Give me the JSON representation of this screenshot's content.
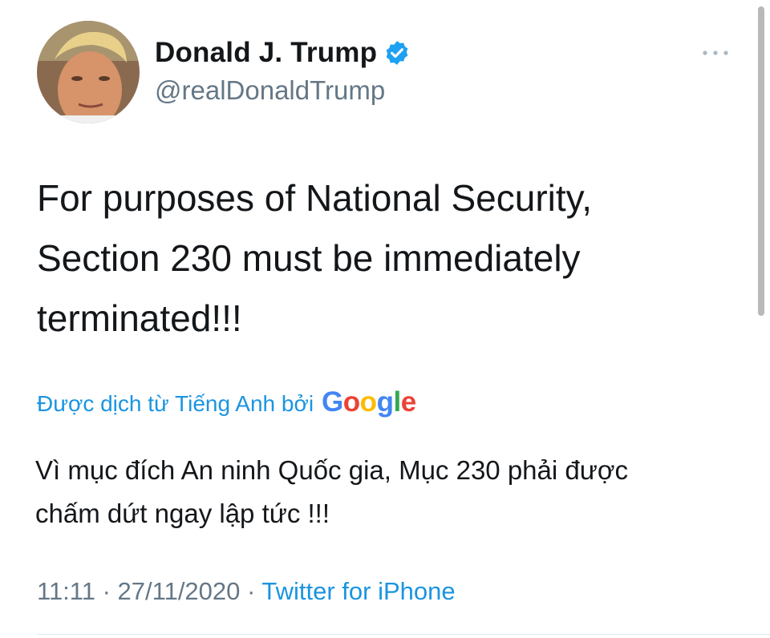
{
  "author": {
    "display_name": "Donald J. Trump",
    "handle": "@realDonaldTrump",
    "verified": true,
    "avatar_icon": "profile-photo"
  },
  "tweet": {
    "text_lines": [
      "For purposes of National Security,",
      "Section 230 must be immediately",
      "terminated!!!"
    ]
  },
  "translation": {
    "label": "Được dịch từ Tiếng Anh bởi",
    "provider": "Google",
    "text_lines": [
      "Vì mục đích An ninh Quốc gia, Mục 230 phải được",
      "chấm dứt ngay lập tức !!!"
    ]
  },
  "meta": {
    "time": "11:11",
    "separator": " · ",
    "date": "27/11/2020",
    "source": "Twitter for iPhone"
  },
  "colors": {
    "link": "#1b95e0",
    "secondary_text": "#657786",
    "verified_badge": "#1da1f2"
  },
  "icons": {
    "verified": "verified-badge-icon",
    "more": "more-options-icon"
  }
}
